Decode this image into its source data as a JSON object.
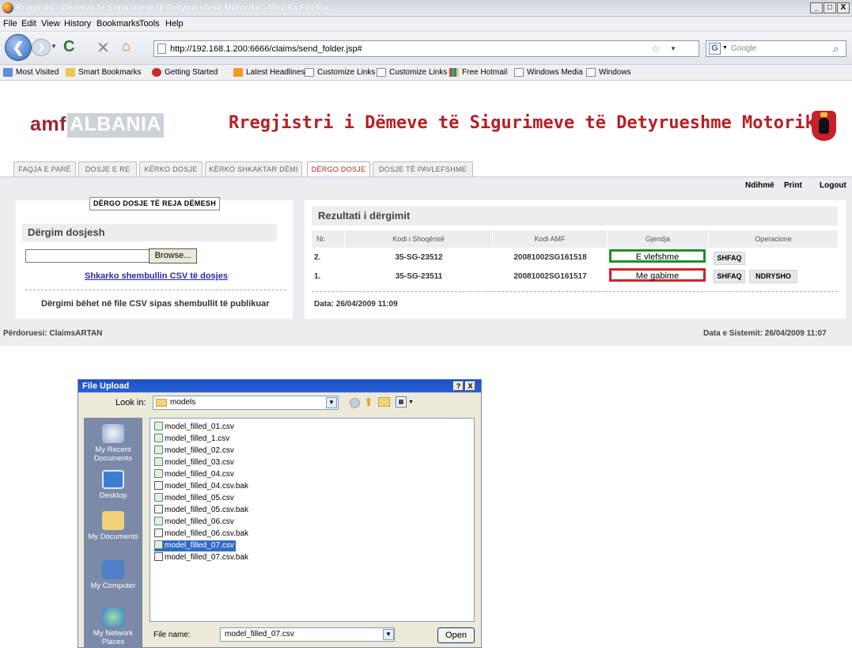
{
  "window": {
    "title": "Rregjistri i Dëmeve të Sigurimeve të Detyrueshme Motorike - Mozilla Firefox",
    "min": "_",
    "max": "□",
    "close": "X"
  },
  "menu": [
    "File",
    "Edit",
    "View",
    "History",
    "Bookmarks",
    "Tools",
    "Help"
  ],
  "nav": {
    "url": "http://192.168.1.200:6666/claims/send_folder.jsp#",
    "search_placeholder": "Google"
  },
  "bookmarks": [
    "Most Visited",
    "Smart Bookmarks",
    "Getting Started",
    "Latest Headlines",
    "Customize Links",
    "Customize Links",
    "Free Hotmail",
    "Windows Media",
    "Windows"
  ],
  "header": {
    "logo_amf": "amf",
    "logo_albania": "ALBANIA",
    "title": "Rregjistri i Dëmeve të Sigurimeve të Detyrueshme Motorike"
  },
  "tabs": [
    "FAQJA E PARË",
    "DOSJE E RE",
    "KËRKO DOSJE",
    "KËRKO SHKAKTAR DËMI",
    "DËRGO DOSJE",
    "DOSJE TË PAVLEFSHME"
  ],
  "toplinks": [
    "Ndihmë",
    "Print",
    "Logout"
  ],
  "left": {
    "button": "DËRGO DOSJE TË REJA DËMESH",
    "header": "Dërgim dosjesh",
    "browse": "Browse...",
    "link": "Shkarko shembullin CSV të dosjes",
    "note": "Dërgimi bëhet në file CSV sipas shembullit të publikuar"
  },
  "right": {
    "header": "Rezultati i dërgimit",
    "columns": [
      "Nr.",
      "Kodi i Shoqërisë",
      "Kodi AMF",
      "Gjendja",
      "Operacione"
    ],
    "rows": [
      {
        "nr": "2.",
        "kodi": "35-SG-23512",
        "amf": "20081002SG161518",
        "status": "E vlefshme",
        "ops": [
          "SHFAQ"
        ]
      },
      {
        "nr": "1.",
        "kodi": "35-SG-23511",
        "amf": "20081002SG161517",
        "status": "Me gabime",
        "ops": [
          "SHFAQ",
          "NDRYSHO"
        ]
      }
    ],
    "date": "Data: 26/04/2009 11:09"
  },
  "footer": {
    "user": "Përdoruesi: ClaimsARTAN",
    "sysdate": "Data e Sistemit: 26/04/2009 11:07"
  },
  "colors": {
    "valid": "#1f8f2a",
    "error": "#d0212b",
    "accent": "#b42024"
  },
  "dialog": {
    "title": "File Upload",
    "help": "?",
    "close": "X",
    "lookin_label": "Look in:",
    "lookin_value": "models",
    "places": [
      "My Recent Documents",
      "Desktop",
      "My Documents",
      "My Computer",
      "My Network Places"
    ],
    "files": [
      {
        "name": "model_filled_01.csv",
        "type": "csv"
      },
      {
        "name": "model_filled_1.csv",
        "type": "csv"
      },
      {
        "name": "model_filled_02.csv",
        "type": "csv"
      },
      {
        "name": "model_filled_03.csv",
        "type": "csv"
      },
      {
        "name": "model_filled_04.csv",
        "type": "csv"
      },
      {
        "name": "model_filled_04.csv.bak",
        "type": "bak"
      },
      {
        "name": "model_filled_05.csv",
        "type": "csv"
      },
      {
        "name": "model_filled_05.csv.bak",
        "type": "bak"
      },
      {
        "name": "model_filled_06.csv",
        "type": "csv"
      },
      {
        "name": "model_filled_06.csv.bak",
        "type": "bak"
      },
      {
        "name": "model_filled_07.csv",
        "type": "csv",
        "selected": true
      },
      {
        "name": "model_filled_07.csv.bak",
        "type": "bak"
      }
    ],
    "filename_label": "File name:",
    "filename_value": "model_filled_07.csv",
    "open": "Open"
  }
}
